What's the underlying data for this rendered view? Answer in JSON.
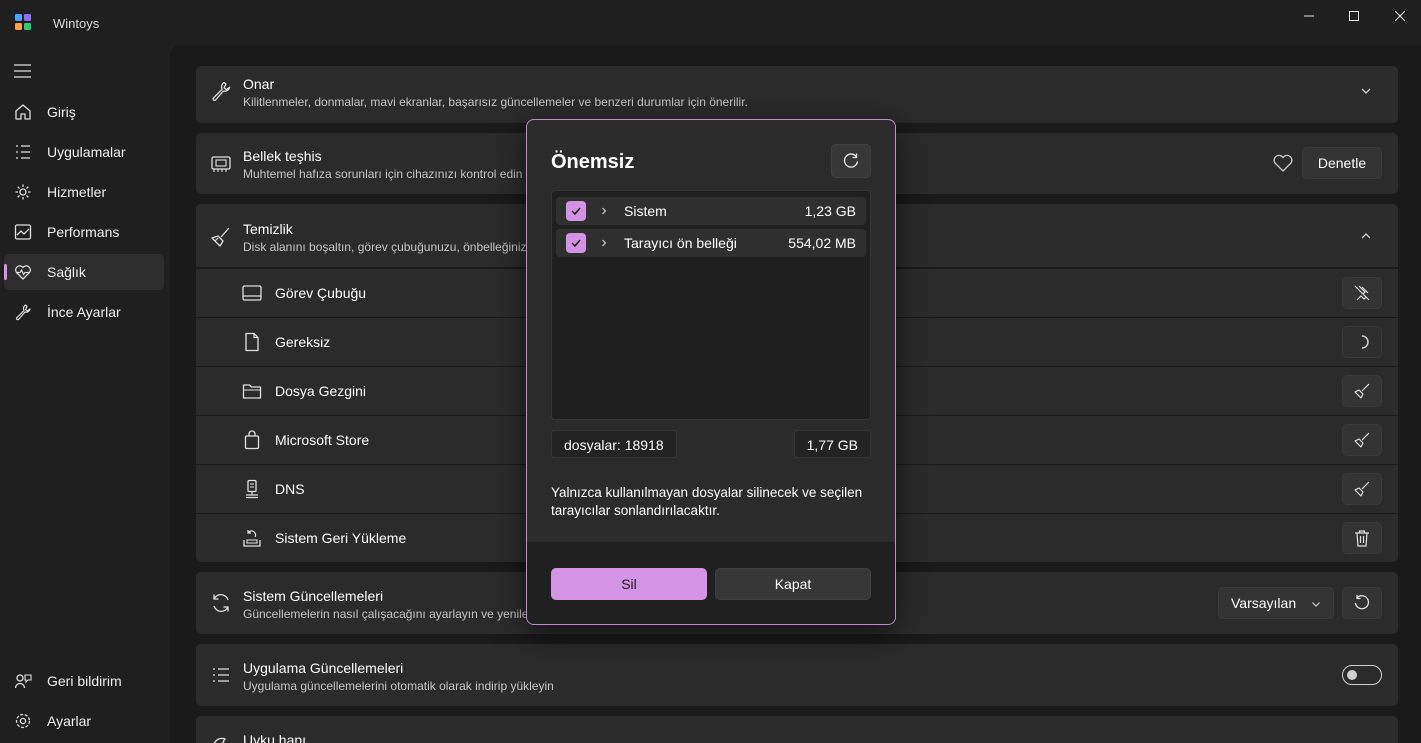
{
  "app": {
    "title": "Wintoys"
  },
  "colors": {
    "accent": "#d494e6",
    "background": "#1a1a1a",
    "card": "#2b2b2b"
  },
  "sidebar": {
    "items": [
      {
        "label": "Giriş",
        "icon": "home-icon"
      },
      {
        "label": "Uygulamalar",
        "icon": "apps-list-icon"
      },
      {
        "label": "Hizmetler",
        "icon": "gear-icon"
      },
      {
        "label": "Performans",
        "icon": "performance-chart-icon"
      },
      {
        "label": "Sağlık",
        "icon": "heart-pulse-icon",
        "active": true
      },
      {
        "label": "İnce Ayarlar",
        "icon": "wrench-icon"
      }
    ],
    "bottom_items": [
      {
        "label": "Geri bildirim",
        "icon": "feedback-icon"
      },
      {
        "label": "Ayarlar",
        "icon": "settings-icon"
      }
    ]
  },
  "cards": {
    "repair": {
      "title": "Onar",
      "subtitle": "Kilitlenmeler, donmalar, mavi ekranlar, başarısız güncellemeler ve benzeri durumlar için önerilir."
    },
    "memory": {
      "title": "Bellek teşhis",
      "subtitle": "Muhtemel hafıza sorunları için cihazınızı kontrol edin",
      "button": "Denetle"
    },
    "cleanup": {
      "title": "Temizlik",
      "subtitle": "Disk alanını boşaltın, görev çubuğunuzu, önbelleğinizi",
      "items": [
        {
          "label": "Görev Çubuğu",
          "icon": "taskbar-icon",
          "action_icon": "unpin-icon"
        },
        {
          "label": "Gereksiz",
          "icon": "document-icon",
          "action_icon": "loading-spinner-icon"
        },
        {
          "label": "Dosya Gezgini",
          "icon": "folder-icon",
          "action_icon": "broom-icon"
        },
        {
          "label": "Microsoft Store",
          "icon": "store-bag-icon",
          "action_icon": "broom-icon"
        },
        {
          "label": "DNS",
          "icon": "network-icon",
          "action_icon": "broom-icon"
        },
        {
          "label": "Sistem Geri Yükleme",
          "icon": "system-restore-icon",
          "action_icon": "trash-icon"
        }
      ]
    },
    "updates": {
      "title": "Sistem Güncellemeleri",
      "subtitle": "Güncellemelerin nasıl çalışacağını ayarlayın ve yenileri",
      "dropdown_value": "Varsayılan"
    },
    "app_updates": {
      "title": "Uygulama Güncellemeleri",
      "subtitle": "Uygulama güncellemelerini otomatik olarak indirip yükleyin",
      "toggle_on": false
    },
    "sleep": {
      "title": "Uyku hapı"
    }
  },
  "dialog": {
    "title": "Önemsiz",
    "rows": [
      {
        "name": "Sistem",
        "size": "1,23 GB",
        "checked": true
      },
      {
        "name": "Tarayıcı ön belleği",
        "size": "554,02 MB",
        "checked": true
      }
    ],
    "files_count": "dosyalar: 18918",
    "total_size": "1,77 GB",
    "note": "Yalnızca kullanılmayan dosyalar silinecek ve seçilen tarayıcılar sonlandırılacaktır.",
    "primary_button": "Sil",
    "secondary_button": "Kapat"
  }
}
